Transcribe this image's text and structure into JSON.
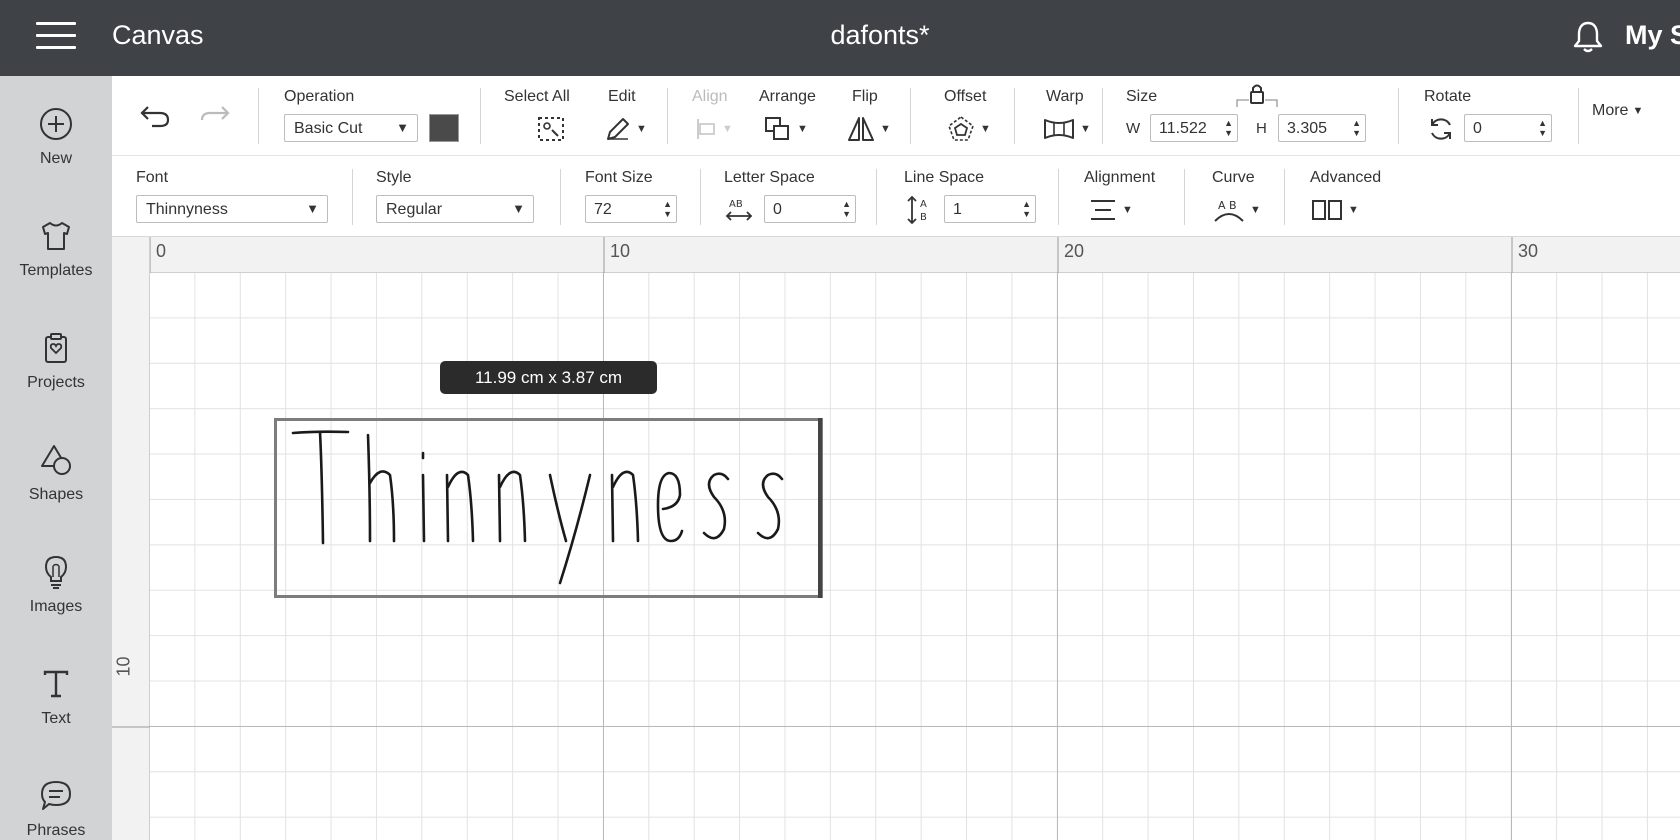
{
  "topbar": {
    "app_title": "Canvas",
    "doc_title": "dafonts*",
    "account_label": "My S"
  },
  "sidebar": {
    "items": [
      {
        "label": "New",
        "icon": "plus-circle-icon"
      },
      {
        "label": "Templates",
        "icon": "tshirt-icon"
      },
      {
        "label": "Projects",
        "icon": "clipboard-heart-icon"
      },
      {
        "label": "Shapes",
        "icon": "shapes-icon"
      },
      {
        "label": "Images",
        "icon": "lightbulb-icon"
      },
      {
        "label": "Text",
        "icon": "text-t-icon"
      },
      {
        "label": "Phrases",
        "icon": "speech-bubble-icon"
      }
    ]
  },
  "toolbar1": {
    "operation_label": "Operation",
    "operation_value": "Basic Cut",
    "operation_color": "#4a4a4a",
    "select_all_label": "Select All",
    "edit_label": "Edit",
    "align_label": "Align",
    "arrange_label": "Arrange",
    "flip_label": "Flip",
    "offset_label": "Offset",
    "warp_label": "Warp",
    "size_label": "Size",
    "width_prefix": "W",
    "width_value": "11.522",
    "height_prefix": "H",
    "height_value": "3.305",
    "rotate_label": "Rotate",
    "rotate_value": "0",
    "more_label": "More"
  },
  "toolbar2": {
    "font_label": "Font",
    "font_value": "Thinnyness",
    "style_label": "Style",
    "style_value": "Regular",
    "font_size_label": "Font Size",
    "font_size_value": "72",
    "letter_space_label": "Letter Space",
    "letter_space_value": "0",
    "line_space_label": "Line Space",
    "line_space_value": "1",
    "alignment_label": "Alignment",
    "curve_label": "Curve",
    "advanced_label": "Advanced"
  },
  "canvas": {
    "ruler_h": [
      "0",
      "10",
      "20",
      "30"
    ],
    "ruler_v": [
      "10"
    ],
    "size_tooltip": "11.99  cm x 3.87  cm",
    "text_object": "Thinnyness"
  },
  "colors": {
    "topbar_bg": "#3f4247",
    "sidebar_bg": "#d2d3d4"
  }
}
